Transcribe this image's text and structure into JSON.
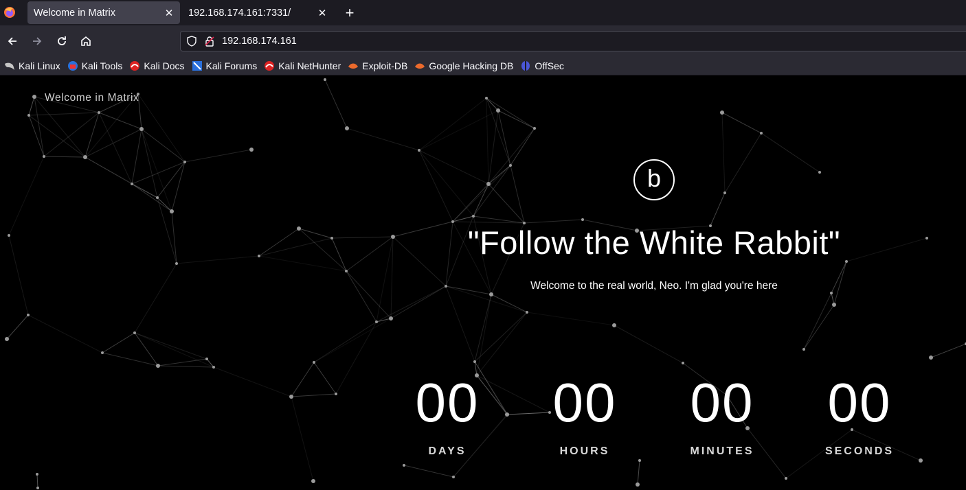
{
  "browser": {
    "tabs": [
      {
        "title": "Welcome in Matrix",
        "active": true
      },
      {
        "title": "192.168.174.161:7331/",
        "active": false
      }
    ],
    "url": "192.168.174.161",
    "bookmarks": [
      {
        "label": "Kali Linux",
        "icon": "kali-dragon-icon"
      },
      {
        "label": "Kali Tools",
        "icon": "kali-tools-icon"
      },
      {
        "label": "Kali Docs",
        "icon": "kali-docs-icon"
      },
      {
        "label": "Kali Forums",
        "icon": "kali-forums-icon"
      },
      {
        "label": "Kali NetHunter",
        "icon": "kali-nethunter-icon"
      },
      {
        "label": "Exploit-DB",
        "icon": "exploit-db-icon"
      },
      {
        "label": "Google Hacking DB",
        "icon": "ghdb-icon"
      },
      {
        "label": "OffSec",
        "icon": "offsec-icon"
      }
    ]
  },
  "page": {
    "site_name": "Welcome in Matrix",
    "logo_letter": "b",
    "headline": "\"Follow the White Rabbit\"",
    "subline": "Welcome to the real world, Neo. I'm glad you're here",
    "countdown": [
      {
        "value": "00",
        "unit": "DAYS"
      },
      {
        "value": "00",
        "unit": "HOURS"
      },
      {
        "value": "00",
        "unit": "MINUTES"
      },
      {
        "value": "00",
        "unit": "SECONDS"
      }
    ]
  },
  "colors": {
    "background": "#000000",
    "text": "#ffffff",
    "chrome_dark": "#1c1b22",
    "chrome": "#2b2a33"
  }
}
